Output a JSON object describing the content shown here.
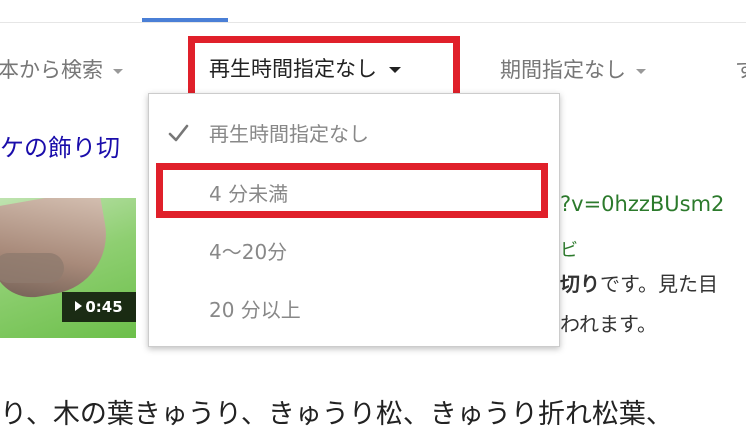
{
  "toolbar": {
    "source_label": "本から検索",
    "duration_label": "再生時間指定なし",
    "period_label": "期間指定なし",
    "more_label": "す"
  },
  "result": {
    "title": "ケの飾り切",
    "duration": "0:45",
    "url": "?v=0hzzBUsm2",
    "url_sub": "ビ",
    "snippet_bold": "切り",
    "snippet_line1_rest": "です。見た目",
    "snippet_line2": "われます。"
  },
  "dropdown": {
    "items": [
      {
        "label": "再生時間指定なし",
        "selected": true
      },
      {
        "label": "4 分未満",
        "selected": false
      },
      {
        "label": "4～20分",
        "selected": false
      },
      {
        "label": "20 分以上",
        "selected": false
      }
    ]
  },
  "bottom_text": "り、木の葉きゅうり、きゅうり松、きゅうり折れ松葉、",
  "colors": {
    "highlight": "#e0202a",
    "link": "#1a0dab",
    "url": "#2c7a2c",
    "tab_indicator": "#4a7fd6"
  }
}
